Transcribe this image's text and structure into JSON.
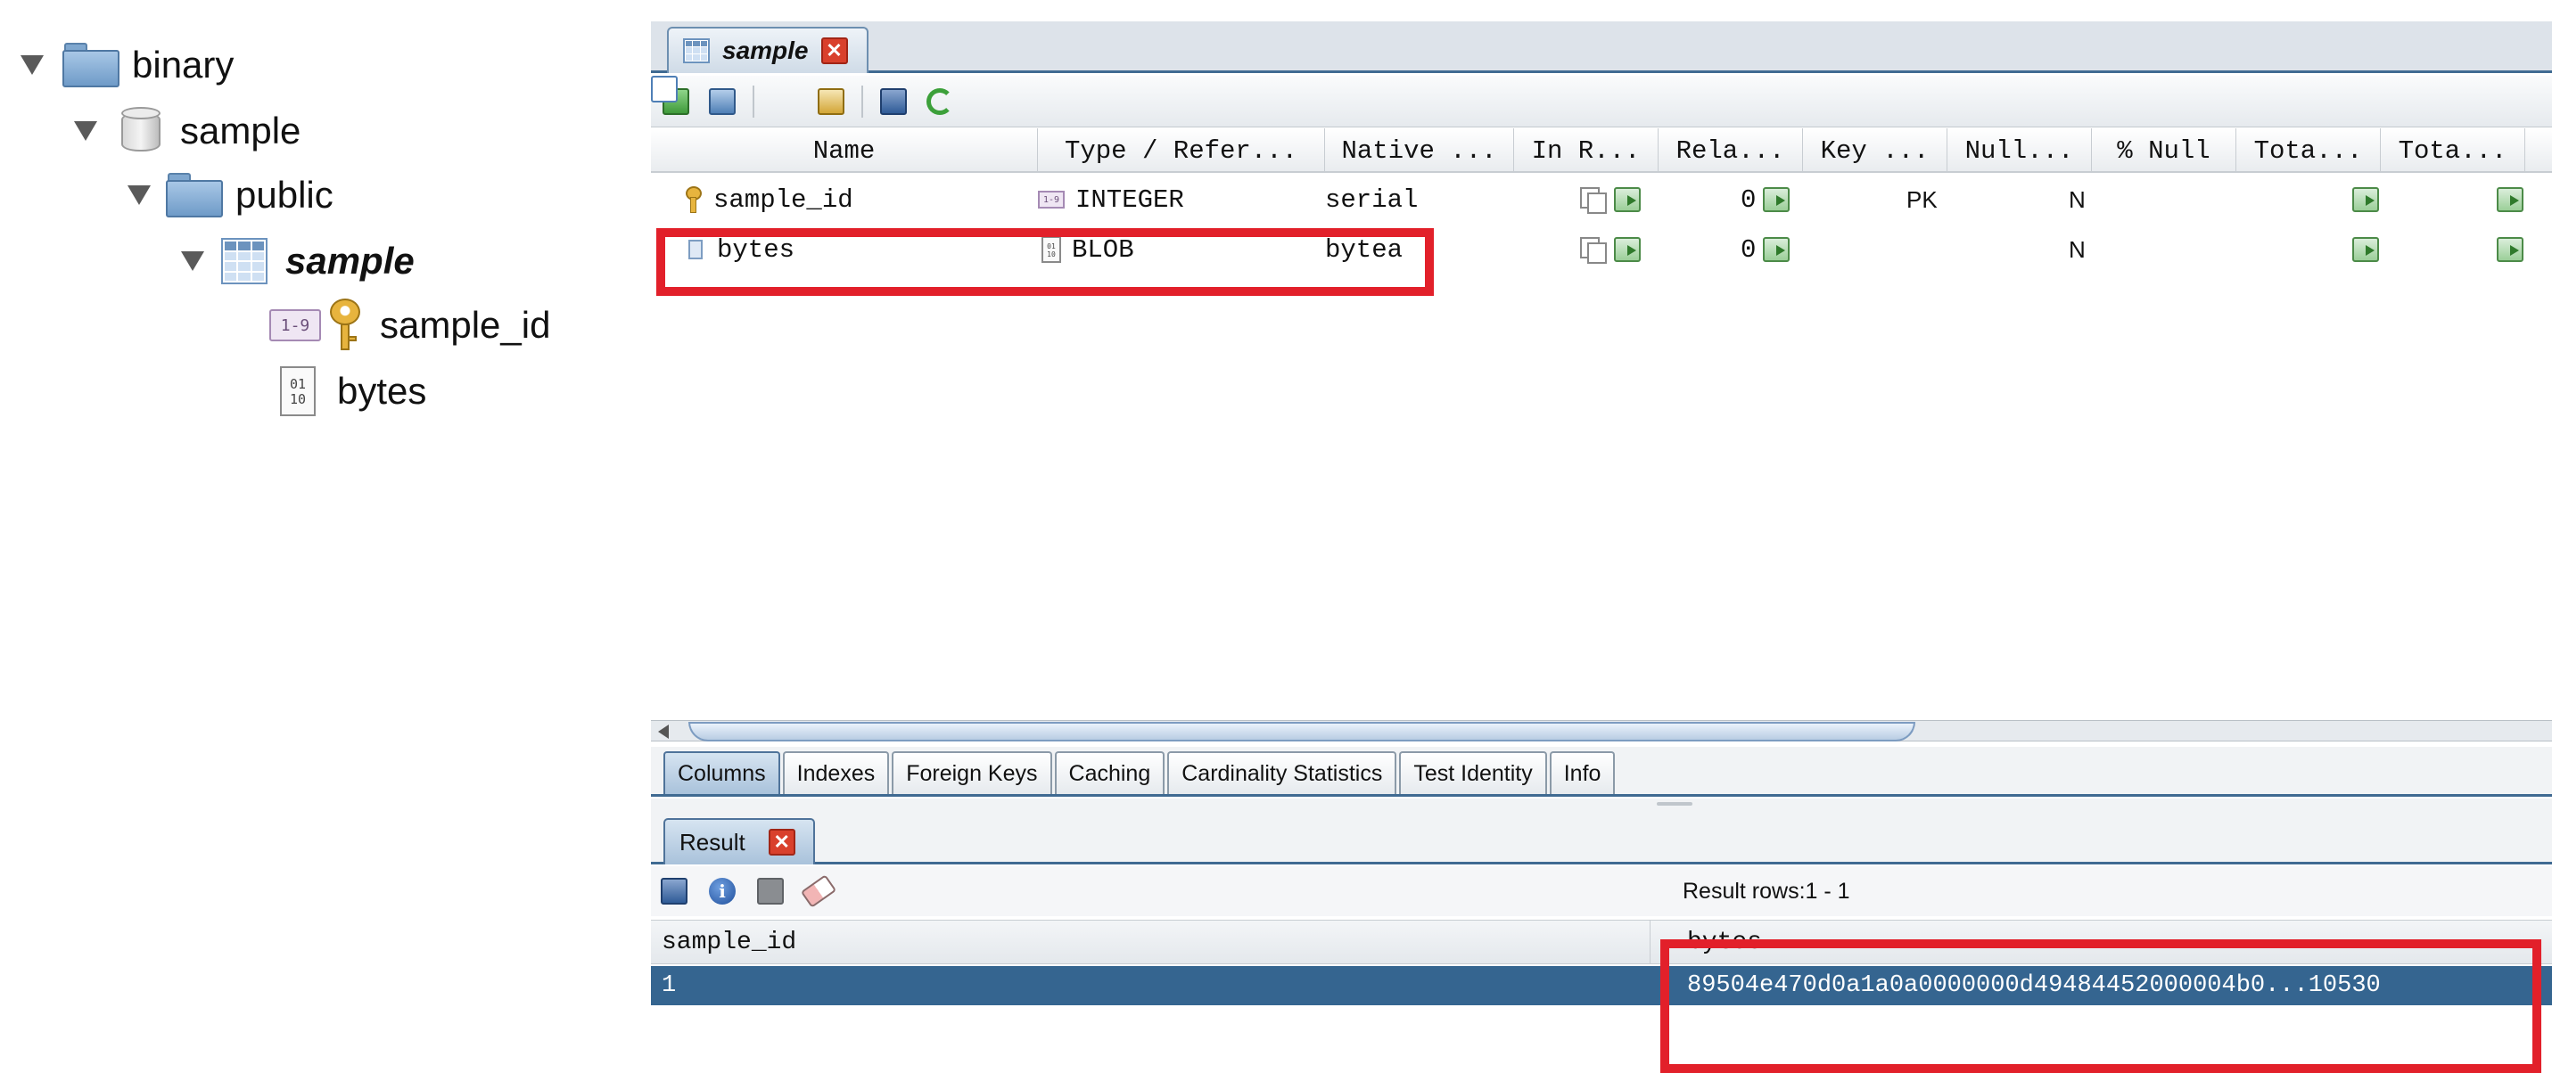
{
  "tree": {
    "nodes": [
      {
        "label": "binary",
        "icon": "folder-icon"
      },
      {
        "label": "sample",
        "icon": "database-icon"
      },
      {
        "label": "public",
        "icon": "folder-icon"
      },
      {
        "label": "sample",
        "icon": "table-icon"
      },
      {
        "label": "sample_id",
        "icon": "key-icon"
      },
      {
        "label": "bytes",
        "icon": "binary-icon"
      }
    ],
    "num_badge": "1-9",
    "bin_glyph_top": "01",
    "bin_glyph_bottom": "10"
  },
  "editor": {
    "tab_label": "sample",
    "close_glyph": "✕"
  },
  "columns_grid": {
    "headers": [
      "Name",
      "Type / Refer...",
      "Native ...",
      "In R...",
      "Rela...",
      "Key ...",
      "Null...",
      "% Null",
      "Tota...",
      "Tota..."
    ],
    "rows": [
      {
        "name": "sample_id",
        "type": "INTEGER",
        "native": "serial",
        "rela": "0",
        "key": "PK",
        "null": "N"
      },
      {
        "name": "bytes",
        "type": "BLOB",
        "native": "bytea",
        "rela": "0",
        "key": "",
        "null": "N"
      }
    ]
  },
  "sub_tabs": [
    "Columns",
    "Indexes",
    "Foreign Keys",
    "Caching",
    "Cardinality Statistics",
    "Test Identity",
    "Info"
  ],
  "result": {
    "tab_label": "Result",
    "rows_label": "Result rows:1 - 1",
    "headers": [
      "sample_id",
      "bytes"
    ],
    "row": {
      "sample_id": "1",
      "bytes": "89504e470d0a1a0a0000000d49484452000004b0...10530"
    }
  },
  "colors": {
    "highlight": "#e2202a",
    "selected_row": "#356590",
    "tab_border": "#3f6a92"
  }
}
